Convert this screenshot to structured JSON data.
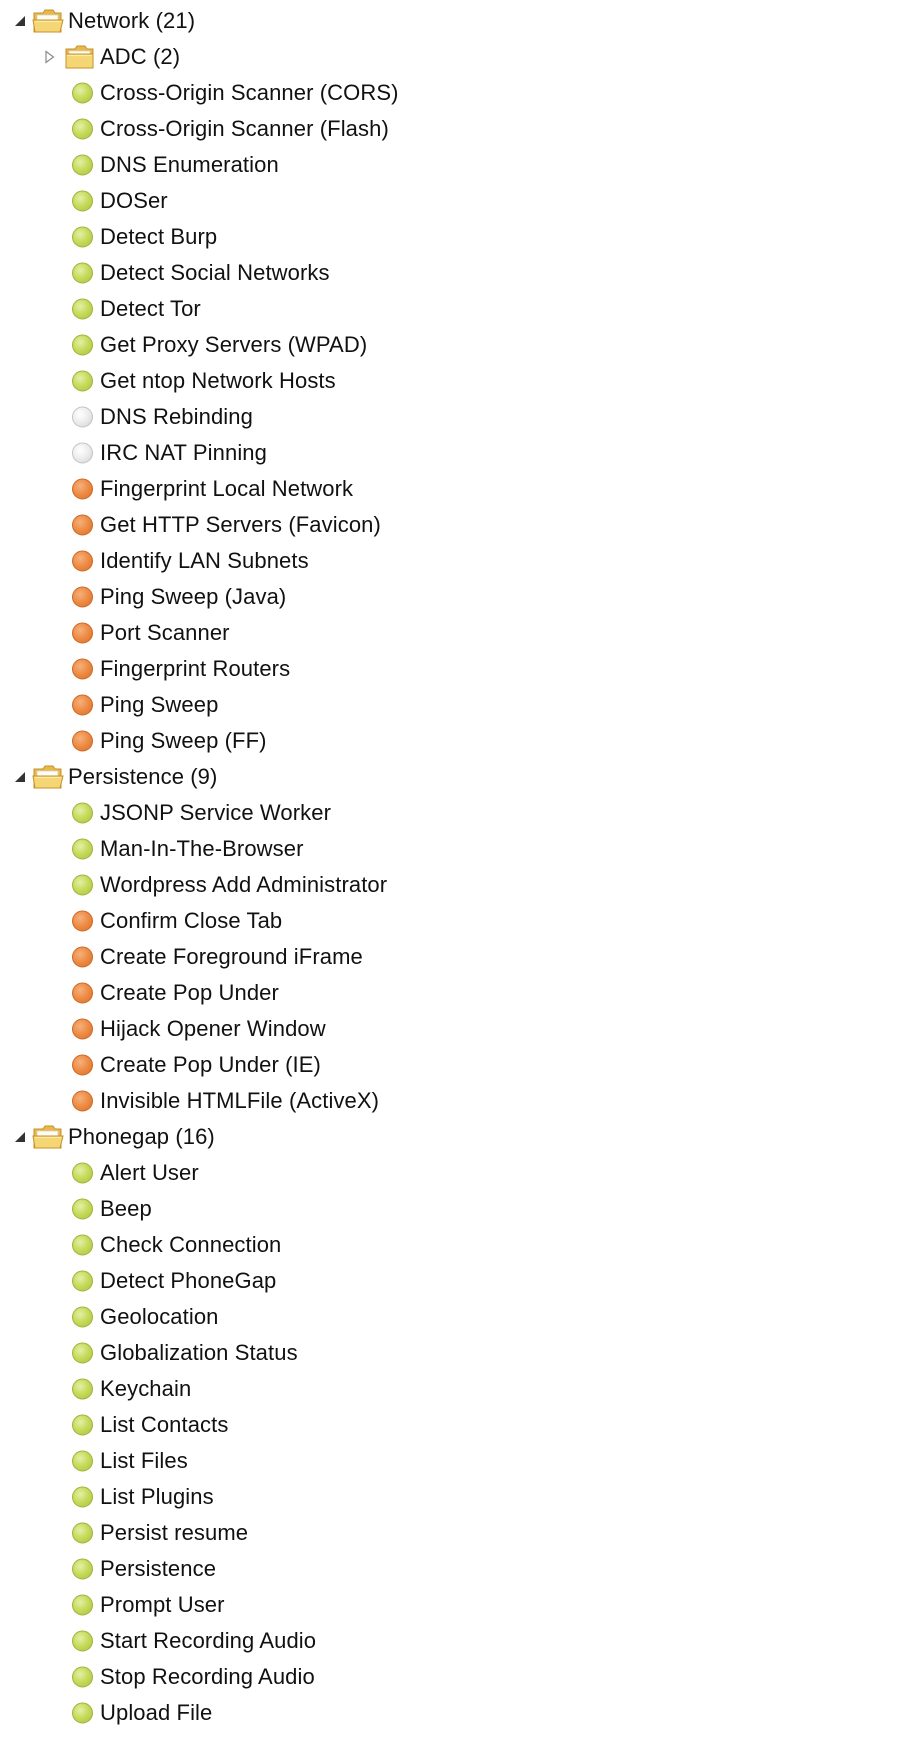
{
  "colors": {
    "status_green": "#c2d85a",
    "status_grey": "#e8e8e8",
    "status_orange": "#ea8840",
    "folder_fill": "#f5d675",
    "folder_edge": "#c8912a"
  },
  "tree": [
    {
      "kind": "folder",
      "label": "Network (21)",
      "expanded": true,
      "icon": "folder-open-icon"
    },
    {
      "kind": "subfolder",
      "label": "ADC (2)",
      "expanded": false,
      "icon": "folder-closed-icon"
    },
    {
      "kind": "leaf",
      "label": "Cross-Origin Scanner (CORS)",
      "status": "green"
    },
    {
      "kind": "leaf",
      "label": "Cross-Origin Scanner (Flash)",
      "status": "green"
    },
    {
      "kind": "leaf",
      "label": "DNS Enumeration",
      "status": "green"
    },
    {
      "kind": "leaf",
      "label": "DOSer",
      "status": "green"
    },
    {
      "kind": "leaf",
      "label": "Detect Burp",
      "status": "green"
    },
    {
      "kind": "leaf",
      "label": "Detect Social Networks",
      "status": "green"
    },
    {
      "kind": "leaf",
      "label": "Detect Tor",
      "status": "green"
    },
    {
      "kind": "leaf",
      "label": "Get Proxy Servers (WPAD)",
      "status": "green"
    },
    {
      "kind": "leaf",
      "label": "Get ntop Network Hosts",
      "status": "green"
    },
    {
      "kind": "leaf",
      "label": "DNS Rebinding",
      "status": "grey"
    },
    {
      "kind": "leaf",
      "label": "IRC NAT Pinning",
      "status": "grey"
    },
    {
      "kind": "leaf",
      "label": "Fingerprint Local Network",
      "status": "orange"
    },
    {
      "kind": "leaf",
      "label": "Get HTTP Servers (Favicon)",
      "status": "orange"
    },
    {
      "kind": "leaf",
      "label": "Identify LAN Subnets",
      "status": "orange"
    },
    {
      "kind": "leaf",
      "label": "Ping Sweep (Java)",
      "status": "orange"
    },
    {
      "kind": "leaf",
      "label": "Port Scanner",
      "status": "orange"
    },
    {
      "kind": "leaf",
      "label": "Fingerprint Routers",
      "status": "orange"
    },
    {
      "kind": "leaf",
      "label": "Ping Sweep",
      "status": "orange"
    },
    {
      "kind": "leaf",
      "label": "Ping Sweep (FF)",
      "status": "orange"
    },
    {
      "kind": "folder",
      "label": "Persistence (9)",
      "expanded": true,
      "icon": "folder-open-icon"
    },
    {
      "kind": "leaf",
      "label": "JSONP Service Worker",
      "status": "green"
    },
    {
      "kind": "leaf",
      "label": "Man-In-The-Browser",
      "status": "green"
    },
    {
      "kind": "leaf",
      "label": "Wordpress Add Administrator",
      "status": "green"
    },
    {
      "kind": "leaf",
      "label": "Confirm Close Tab",
      "status": "orange"
    },
    {
      "kind": "leaf",
      "label": "Create Foreground iFrame",
      "status": "orange"
    },
    {
      "kind": "leaf",
      "label": "Create Pop Under",
      "status": "orange"
    },
    {
      "kind": "leaf",
      "label": "Hijack Opener Window",
      "status": "orange"
    },
    {
      "kind": "leaf",
      "label": "Create Pop Under (IE)",
      "status": "orange"
    },
    {
      "kind": "leaf",
      "label": "Invisible HTMLFile (ActiveX)",
      "status": "orange"
    },
    {
      "kind": "folder",
      "label": "Phonegap (16)",
      "expanded": true,
      "icon": "folder-open-icon"
    },
    {
      "kind": "leaf",
      "label": "Alert User",
      "status": "green"
    },
    {
      "kind": "leaf",
      "label": "Beep",
      "status": "green"
    },
    {
      "kind": "leaf",
      "label": "Check Connection",
      "status": "green"
    },
    {
      "kind": "leaf",
      "label": "Detect PhoneGap",
      "status": "green"
    },
    {
      "kind": "leaf",
      "label": "Geolocation",
      "status": "green"
    },
    {
      "kind": "leaf",
      "label": "Globalization Status",
      "status": "green"
    },
    {
      "kind": "leaf",
      "label": "Keychain",
      "status": "green"
    },
    {
      "kind": "leaf",
      "label": "List Contacts",
      "status": "green"
    },
    {
      "kind": "leaf",
      "label": "List Files",
      "status": "green"
    },
    {
      "kind": "leaf",
      "label": "List Plugins",
      "status": "green"
    },
    {
      "kind": "leaf",
      "label": "Persist resume",
      "status": "green"
    },
    {
      "kind": "leaf",
      "label": "Persistence",
      "status": "green"
    },
    {
      "kind": "leaf",
      "label": "Prompt User",
      "status": "green"
    },
    {
      "kind": "leaf",
      "label": "Start Recording Audio",
      "status": "green"
    },
    {
      "kind": "leaf",
      "label": "Stop Recording Audio",
      "status": "green"
    },
    {
      "kind": "leaf",
      "label": "Upload File",
      "status": "green"
    }
  ]
}
